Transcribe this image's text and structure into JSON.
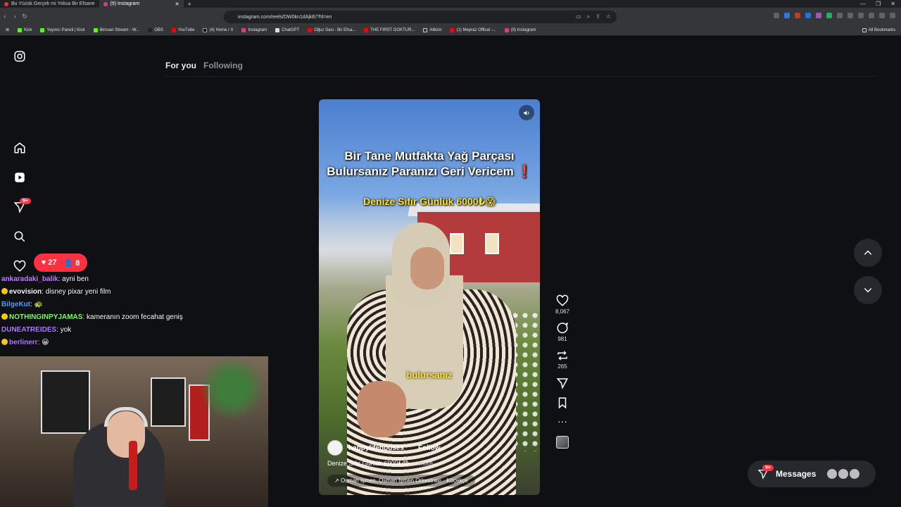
{
  "browser": {
    "tabs": [
      {
        "title": "Bu Yüzük Gerçek mi Yoksa Bir Efsane"
      },
      {
        "title": "(9) Instagram",
        "active": true
      }
    ],
    "new_tab": "+",
    "url": "instagram.com/reels/DW0kn1dAjkE/?hl=en",
    "bookmarks": [
      "Kick",
      "Yayıncı Paneli | Kick",
      "ilkinsan Stream - W...",
      "OBS",
      "YouTube",
      "(4) Home / X",
      "Instagram",
      "ChatGPT",
      "Oğuz Sasi - Bir Efsa...",
      "THE FIRST GOKTUR...",
      "Albüm",
      "(1) Mepraz Offical -...",
      "(9) Instagram"
    ],
    "all_bookmarks": "All Bookmarks"
  },
  "sidebar": {
    "notifications_badge": "9+"
  },
  "feed_tabs": {
    "for_you": "For you",
    "following": "Following"
  },
  "reel": {
    "overlay_title": "Bir Tane Mutfakta Yağ Parçası Bulursanız Paranızı Geri Vericem",
    "overlay_exclaim": "❗",
    "overlay_sub": "Denize Sıfır Günlük 6000₺😱",
    "caption_word": "bulursanız",
    "account": "happylifehouses",
    "follow": "Follow",
    "description": "Denize Sıfır Günlük 6000₺😱",
    "more": "... more",
    "audio": "Osman İşmen, Osman İşmen Orkestrası · Köçekçe"
  },
  "actions": {
    "likes": "8,067",
    "comments": "981",
    "reposts": "265"
  },
  "messages": {
    "label": "Messages",
    "badge": "9+"
  },
  "stream_overlay": {
    "likes": "27",
    "followers": "8",
    "chat": [
      {
        "user": "ankaradaki_balik",
        "text": "ayni ben"
      },
      {
        "user": "evovision",
        "text": "disney pixar yeni film"
      },
      {
        "user": "BilgeKut",
        "text": "🐢"
      },
      {
        "user": "NOTHINGINPYJAMAS",
        "text": "kameranın zoom fecahat geniş"
      },
      {
        "user": "DUNEATREIDES",
        "text": "yok"
      },
      {
        "user": "berlinerr",
        "text": "😀"
      }
    ]
  },
  "colors": {
    "background": "#0e1013",
    "badge_red": "#ff3040",
    "caption_yellow": "#ffe030"
  }
}
